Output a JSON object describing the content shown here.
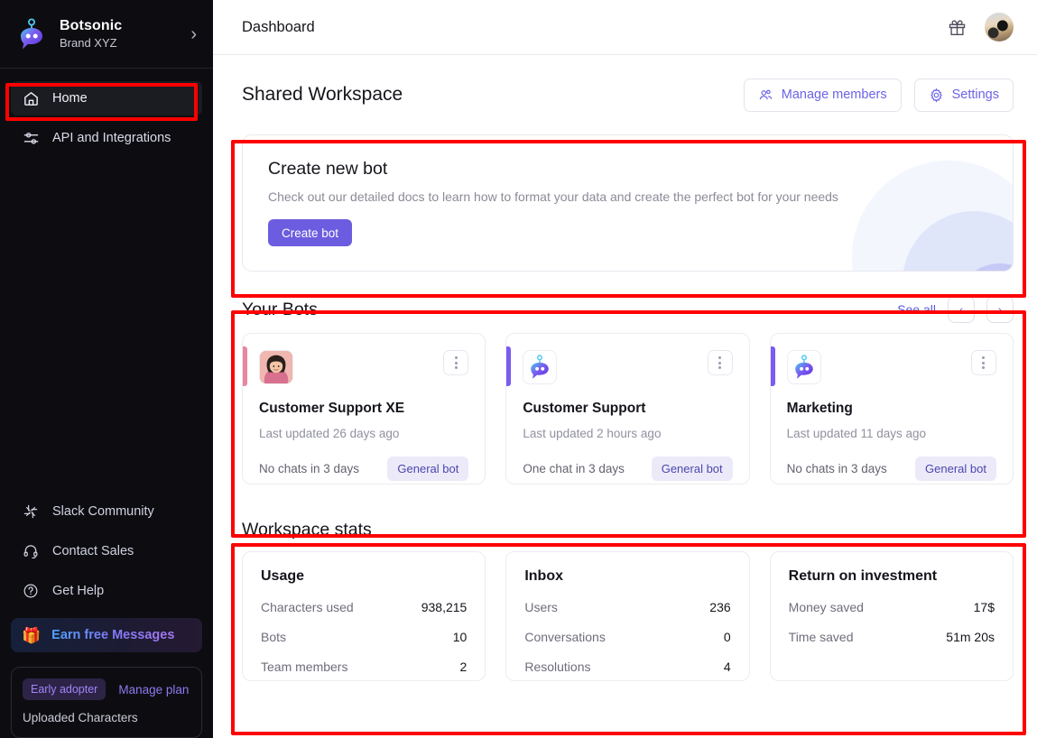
{
  "sidebar": {
    "brand": {
      "name": "Botsonic",
      "sub": "Brand XYZ",
      "chevron": "›",
      "logo_icon": "botsonic-logo-icon"
    },
    "nav": [
      {
        "label": "Home",
        "icon": "home-icon",
        "active": true
      },
      {
        "label": "API and Integrations",
        "icon": "sliders-icon",
        "active": false
      }
    ],
    "bottom_nav": [
      {
        "label": "Slack Community",
        "icon": "slack-icon"
      },
      {
        "label": "Contact Sales",
        "icon": "headset-icon"
      },
      {
        "label": "Get Help",
        "icon": "question-circle-icon"
      }
    ],
    "earn": {
      "label": "Earn free Messages",
      "icon": "gift-box-icon"
    },
    "plan": {
      "badge": "Early adopter",
      "manage": "Manage plan",
      "usage_label": "Uploaded Characters"
    }
  },
  "topbar": {
    "title": "Dashboard",
    "gift_icon": "gift-icon",
    "avatar_icon": "user-avatar"
  },
  "workspace": {
    "title": "Shared Workspace",
    "manage_members": "Manage members",
    "manage_members_icon": "people-group-icon",
    "settings": "Settings",
    "settings_icon": "gear-icon"
  },
  "create_bot": {
    "title": "Create new bot",
    "description": "Check out our detailed docs to learn how to format your data and create the perfect bot for your needs",
    "button": "Create bot"
  },
  "your_bots": {
    "title": "Your Bots",
    "see_all": "See all",
    "prev_icon": "chevron-left-icon",
    "next_icon": "chevron-right-icon",
    "cards": [
      {
        "name": "Customer Support XE",
        "updated": "Last updated 26 days ago",
        "chats": "No chats in 3 days",
        "tag": "General bot",
        "accent": "#e8879f",
        "avatar_type": "person"
      },
      {
        "name": "Customer Support",
        "updated": "Last updated 2 hours ago",
        "chats": "One chat in 3 days",
        "tag": "General bot",
        "accent": "#7a5cf0",
        "avatar_type": "bot"
      },
      {
        "name": "Marketing",
        "updated": "Last updated 11 days ago",
        "chats": "No chats in 3 days",
        "tag": "General bot",
        "accent": "#7a5cf0",
        "avatar_type": "bot"
      }
    ]
  },
  "stats": {
    "title": "Workspace stats",
    "cards": [
      {
        "title": "Usage",
        "rows": [
          {
            "key": "Characters used",
            "value": "938,215"
          },
          {
            "key": "Bots",
            "value": "10"
          },
          {
            "key": "Team members",
            "value": "2"
          }
        ]
      },
      {
        "title": "Inbox",
        "rows": [
          {
            "key": "Users",
            "value": "236"
          },
          {
            "key": "Conversations",
            "value": "0"
          },
          {
            "key": "Resolutions",
            "value": "4"
          }
        ]
      },
      {
        "title": "Return on investment",
        "rows": [
          {
            "key": "Money saved",
            "value": "17$"
          },
          {
            "key": "Time saved",
            "value": "51m 20s"
          }
        ]
      }
    ]
  },
  "annotations": {
    "color": "#fe0000",
    "boxes": [
      "home-nav-item",
      "create-new-bot-card",
      "your-bots-section",
      "workspace-stats-section"
    ]
  }
}
